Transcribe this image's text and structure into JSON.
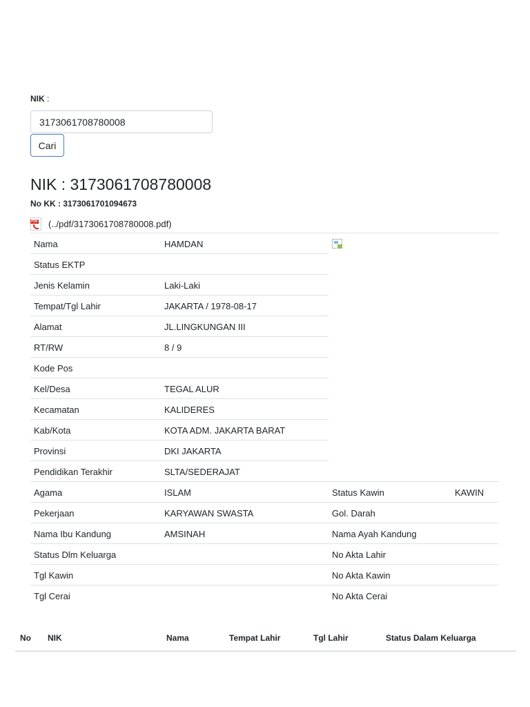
{
  "search": {
    "label": "NIK",
    "label_suffix": " :",
    "input_value": "3173061708780008",
    "button_label": "Cari"
  },
  "result": {
    "heading": "NIK : 3173061708780008",
    "no_kk": "No KK : 3173061701094673",
    "pdf_link": "(../pdf/3173061708780008.pdf)",
    "pdf_icon": "pdf-file-icon",
    "photo_icon": "broken-image-icon"
  },
  "detail": {
    "rows": [
      {
        "label": "Nama",
        "value": "HAMDAN"
      },
      {
        "label": "Status EKTP",
        "value": ""
      },
      {
        "label": "Jenis Kelamin",
        "value": "Laki-Laki"
      },
      {
        "label": "Tempat/Tgl Lahir",
        "value": "JAKARTA / 1978-08-17"
      },
      {
        "label": "Alamat",
        "value": "JL.LINGKUNGAN III"
      },
      {
        "label": "RT/RW",
        "value": "8 / 9"
      },
      {
        "label": "Kode Pos",
        "value": ""
      },
      {
        "label": "Kel/Desa",
        "value": "TEGAL ALUR"
      },
      {
        "label": "Kecamatan",
        "value": "KALIDERES"
      },
      {
        "label": "Kab/Kota",
        "value": "KOTA ADM. JAKARTA BARAT"
      },
      {
        "label": "Provinsi",
        "value": "DKI JAKARTA"
      },
      {
        "label": "Pendidikan Terakhir",
        "value": "SLTA/SEDERAJAT"
      },
      {
        "label": "Agama",
        "value": "ISLAM",
        "label2": "Status Kawin",
        "value2": "KAWIN"
      },
      {
        "label": "Pekerjaan",
        "value": "KARYAWAN SWASTA",
        "label2": "Gol. Darah",
        "value2": ""
      },
      {
        "label": "Nama Ibu Kandung",
        "value": "AMSINAH",
        "label2": "Nama Ayah Kandung",
        "value2": ""
      },
      {
        "label": "Status Dlm Keluarga",
        "value": "",
        "label2": "No Akta Lahir",
        "value2": ""
      },
      {
        "label": "Tgl Kawin",
        "value": "",
        "label2": "No Akta Kawin",
        "value2": ""
      },
      {
        "label": "Tgl Cerai",
        "value": "",
        "label2": "No Akta Cerai",
        "value2": ""
      }
    ]
  },
  "family_table": {
    "headers": [
      "No",
      "NIK",
      "Nama",
      "Tempat Lahir",
      "Tgl Lahir",
      "Status Dalam Keluarga"
    ]
  }
}
